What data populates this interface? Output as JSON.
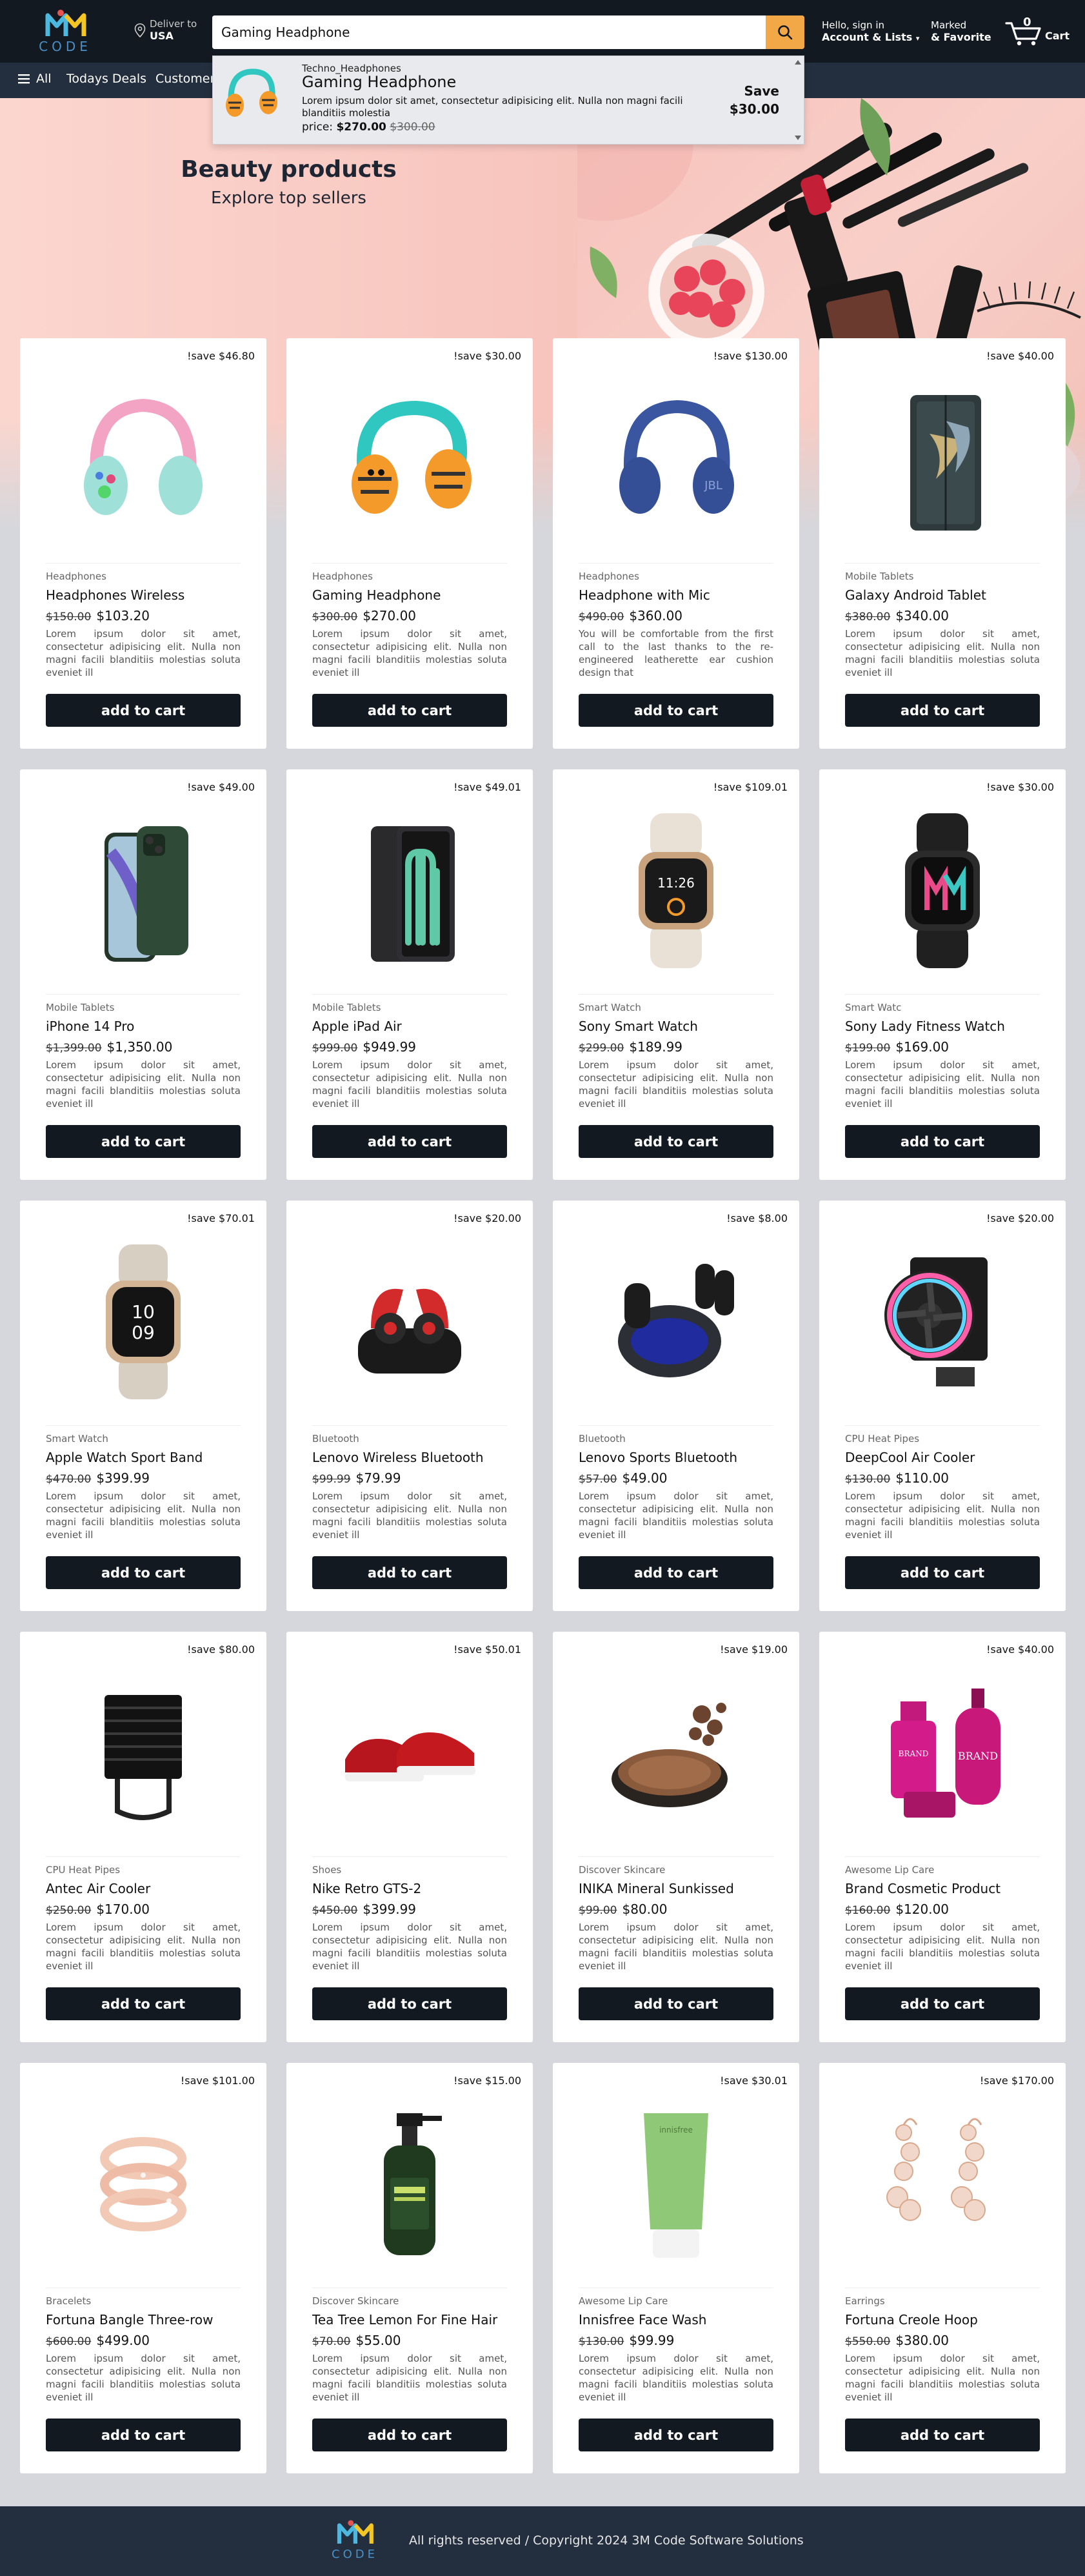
{
  "header": {
    "logo_text": "CODE",
    "deliver_label": "Deliver to",
    "deliver_location": "USA",
    "search_value": "Gaming Headphone",
    "account_line1": "Hello, sign in",
    "account_line2": "Account & Lists",
    "favorite_line1": "Marked",
    "favorite_line2": "& Favorite",
    "cart_count": "0",
    "cart_label": "Cart"
  },
  "nav": {
    "all_label": "All",
    "items": [
      "Todays Deals",
      "Customer"
    ]
  },
  "dropdown": {
    "category": "Techno_Headphones",
    "name": "Gaming Headphone",
    "description": "Lorem ipsum dolor sit amet, consectetur adipisicing elit. Nulla non magni facili blanditiis molestia",
    "price_label": "price:",
    "price": "$270.00",
    "old_price": "$300.00",
    "save_label": "Save",
    "save_amount": "$30.00"
  },
  "hero": {
    "title": "Beauty products",
    "subtitle": "Explore top sellers"
  },
  "products": [
    {
      "save": "!save $46.80",
      "category": "Headphones",
      "title": "Headphones Wireless",
      "old_price": "$150.00",
      "price": "$103.20",
      "description": "Lorem ipsum dolor sit amet, consectetur adipisicing elit. Nulla non magni facili blanditiis molestias soluta eveniet ill",
      "button": "add to cart",
      "icon": "pink-headphones-icon"
    },
    {
      "save": "!save $30.00",
      "category": "Headphones",
      "title": "Gaming Headphone",
      "old_price": "$300.00",
      "price": "$270.00",
      "description": "Lorem ipsum dolor sit amet, consectetur adipisicing elit. Nulla non magni facili blanditiis molestias soluta eveniet ill",
      "button": "add to cart",
      "icon": "kids-headphones-icon"
    },
    {
      "save": "!save $130.00",
      "category": "Headphones",
      "title": "Headphone with Mic",
      "old_price": "$490.00",
      "price": "$360.00",
      "description": "You will be comfortable from the first call to the last thanks to the re-engineered leatherette ear cushion design that",
      "button": "add to cart",
      "icon": "blue-headphones-icon"
    },
    {
      "save": "!save $40.00",
      "category": "Mobile Tablets",
      "title": "Galaxy Android Tablet",
      "old_price": "$380.00",
      "price": "$340.00",
      "description": "Lorem ipsum dolor sit amet, consectetur adipisicing elit. Nulla non magni facili blanditiis molestias soluta eveniet ill",
      "button": "add to cart",
      "icon": "foldable-phone-icon"
    },
    {
      "save": "!save $49.00",
      "category": "Mobile Tablets",
      "title": "iPhone 14 Pro",
      "old_price": "$1,399.00",
      "price": "$1,350.00",
      "description": "Lorem ipsum dolor sit amet, consectetur adipisicing elit. Nulla non magni facili blanditiis molestias soluta eveniet ill",
      "button": "add to cart",
      "icon": "iphone-icon"
    },
    {
      "save": "!save $49.01",
      "category": "Mobile Tablets",
      "title": "Apple iPad Air",
      "old_price": "$999.00",
      "price": "$949.99",
      "description": "Lorem ipsum dolor sit amet, consectetur adipisicing elit. Nulla non magni facili blanditiis molestias soluta eveniet ill",
      "button": "add to cart",
      "icon": "ipad-icon"
    },
    {
      "save": "!save $109.01",
      "category": "Smart Watch",
      "title": "Sony Smart Watch",
      "old_price": "$299.00",
      "price": "$189.99",
      "description": "Lorem ipsum dolor sit amet, consectetur adipisicing elit. Nulla non magni facili blanditiis molestias soluta eveniet ill",
      "button": "add to cart",
      "icon": "white-smartwatch-icon"
    },
    {
      "save": "!save $30.00",
      "category": "Smart Watc",
      "title": "Sony Lady Fitness Watch",
      "old_price": "$199.00",
      "price": "$169.00",
      "description": "Lorem ipsum dolor sit amet, consectetur adipisicing elit. Nulla non magni facili blanditiis molestias soluta eveniet ill",
      "button": "add to cart",
      "icon": "black-smartwatch-icon"
    },
    {
      "save": "!save $70.01",
      "category": "Smart Watch",
      "title": "Apple Watch Sport Band",
      "old_price": "$470.00",
      "price": "$399.99",
      "description": "Lorem ipsum dolor sit amet, consectetur adipisicing elit. Nulla non magni facili blanditiis molestias soluta eveniet ill",
      "button": "add to cart",
      "icon": "apple-watch-icon"
    },
    {
      "save": "!save $20.00",
      "category": "Bluetooth",
      "title": "Lenovo Wireless Bluetooth",
      "old_price": "$99.99",
      "price": "$79.99",
      "description": "Lorem ipsum dolor sit amet, consectetur adipisicing elit. Nulla non magni facili blanditiis molestias soluta eveniet ill",
      "button": "add to cart",
      "icon": "red-earbuds-icon"
    },
    {
      "save": "!save $8.00",
      "category": "Bluetooth",
      "title": "Lenovo Sports Bluetooth",
      "old_price": "$57.00",
      "price": "$49.00",
      "description": "Lorem ipsum dolor sit amet, consectetur adipisicing elit. Nulla non magni facili blanditiis molestias soluta eveniet ill",
      "button": "add to cart",
      "icon": "black-earbuds-icon"
    },
    {
      "save": "!save $20.00",
      "category": "CPU Heat Pipes",
      "title": "DeepCool Air Cooler",
      "old_price": "$130.00",
      "price": "$110.00",
      "description": "Lorem ipsum dolor sit amet, consectetur adipisicing elit. Nulla non magni facili blanditiis molestias soluta eveniet ill",
      "button": "add to cart",
      "icon": "rgb-cooler-icon"
    },
    {
      "save": "!save $80.00",
      "category": "CPU Heat Pipes",
      "title": "Antec Air Cooler",
      "old_price": "$250.00",
      "price": "$170.00",
      "description": "Lorem ipsum dolor sit amet, consectetur adipisicing elit. Nulla non magni facili blanditiis molestias soluta eveniet ill",
      "button": "add to cart",
      "icon": "black-cooler-icon"
    },
    {
      "save": "!save $50.01",
      "category": "Shoes",
      "title": "Nike Retro GTS-2",
      "old_price": "$450.00",
      "price": "$399.99",
      "description": "Lorem ipsum dolor sit amet, consectetur adipisicing elit. Nulla non magni facili blanditiis molestias soluta eveniet ill",
      "button": "add to cart",
      "icon": "red-sneakers-icon"
    },
    {
      "save": "!save $19.00",
      "category": "Discover Skincare",
      "title": "INIKA Mineral Sunkissed",
      "old_price": "$99.00",
      "price": "$80.00",
      "description": "Lorem ipsum dolor sit amet, consectetur adipisicing elit. Nulla non magni facili blanditiis molestias soluta eveniet ill",
      "button": "add to cart",
      "icon": "powder-compact-icon"
    },
    {
      "save": "!save $40.00",
      "category": "Awesome Lip Care",
      "title": "Brand Cosmetic Product",
      "old_price": "$160.00",
      "price": "$120.00",
      "description": "Lorem ipsum dolor sit amet, consectetur adipisicing elit. Nulla non magni facili blanditiis molestias soluta eveniet ill",
      "button": "add to cart",
      "icon": "cosmetic-bottles-icon",
      "brand_text": "BRAND"
    },
    {
      "save": "!save $101.00",
      "category": "Bracelets",
      "title": "Fortuna Bangle Three-row",
      "old_price": "$600.00",
      "price": "$499.00",
      "description": "Lorem ipsum dolor sit amet, consectetur adipisicing elit. Nulla non magni facili blanditiis molestias soluta eveniet ill",
      "button": "add to cart",
      "icon": "bangle-icon"
    },
    {
      "save": "!save $15.00",
      "category": "Discover Skincare",
      "title": "Tea Tree Lemon For Fine Hair",
      "old_price": "$70.00",
      "price": "$55.00",
      "description": "Lorem ipsum dolor sit amet, consectetur adipisicing elit. Nulla non magni facili blanditiis molestias soluta eveniet ill",
      "button": "add to cart",
      "icon": "shampoo-bottle-icon"
    },
    {
      "save": "!save $30.01",
      "category": "Awesome Lip Care",
      "title": "Innisfree Face Wash",
      "old_price": "$130.00",
      "price": "$99.99",
      "description": "Lorem ipsum dolor sit amet, consectetur adipisicing elit. Nulla non magni facili blanditiis molestias soluta eveniet ill",
      "button": "add to cart",
      "icon": "face-wash-tube-icon"
    },
    {
      "save": "!save $170.00",
      "category": "Earrings",
      "title": "Fortuna Creole Hoop",
      "old_price": "$550.00",
      "price": "$380.00",
      "description": "Lorem ipsum dolor sit amet, consectetur adipisicing elit. Nulla non magni facili blanditiis molestias soluta eveniet ill",
      "button": "add to cart",
      "icon": "earrings-icon"
    }
  ],
  "footer": {
    "logo_text": "CODE",
    "text": "All rights reserved / Copyright 2024 3M Code Software Solutions"
  },
  "colors": {
    "header_bg": "#131921",
    "nav_bg": "#232f3e",
    "search_button": "#f3a847",
    "page_bg": "#d5d7dc",
    "button_bg": "#131921"
  }
}
